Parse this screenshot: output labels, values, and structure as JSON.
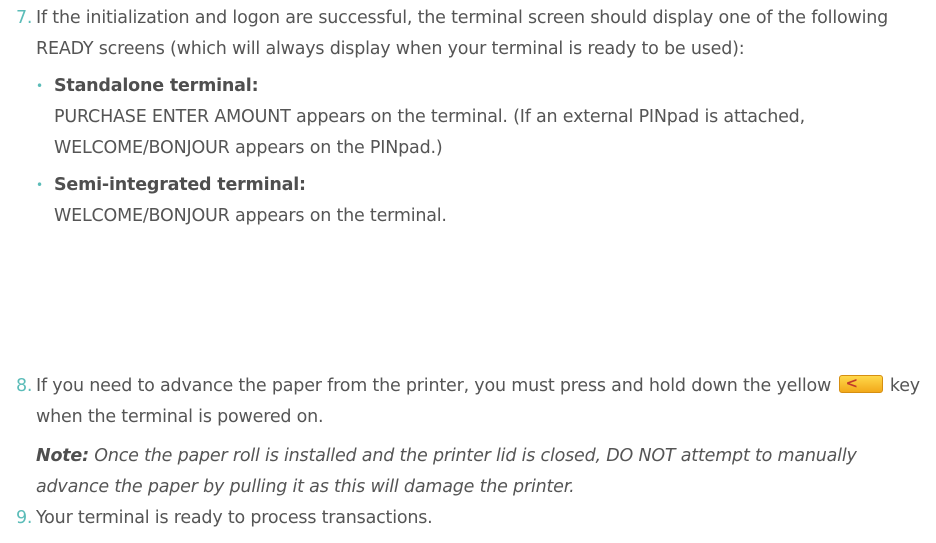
{
  "steps": [
    {
      "number": "7.",
      "text": "If the initialization and logon are successful, the terminal screen should display one of the following READY screens (which will always display when your terminal is ready to be used):",
      "bullets": [
        {
          "title": "Standalone terminal:",
          "text": "PURCHASE ENTER AMOUNT appears on the terminal. (If an external PINpad is attached, WELCOME/BONJOUR appears on the PINpad.)"
        },
        {
          "title": "Semi-integrated terminal:",
          "text": "WELCOME/BONJOUR appears on the terminal."
        }
      ]
    },
    {
      "number": "8.",
      "text_before_key": "If you need to advance the paper from the printer, you must press and hold down the yellow",
      "key_icon": "yellow-arrow-key-icon",
      "text_after_key": "key when the terminal is powered on.",
      "note_label": "Note:",
      "note_text": "Once the paper roll is installed and the printer lid is closed, DO NOT attempt to manually advance the paper by pulling it as this will damage the printer."
    },
    {
      "number": "9.",
      "text": "Your terminal is ready to process transactions."
    }
  ],
  "colors": {
    "accent": "#5bbcb8",
    "text": "#555555",
    "key_fill": "#f5b21f"
  }
}
